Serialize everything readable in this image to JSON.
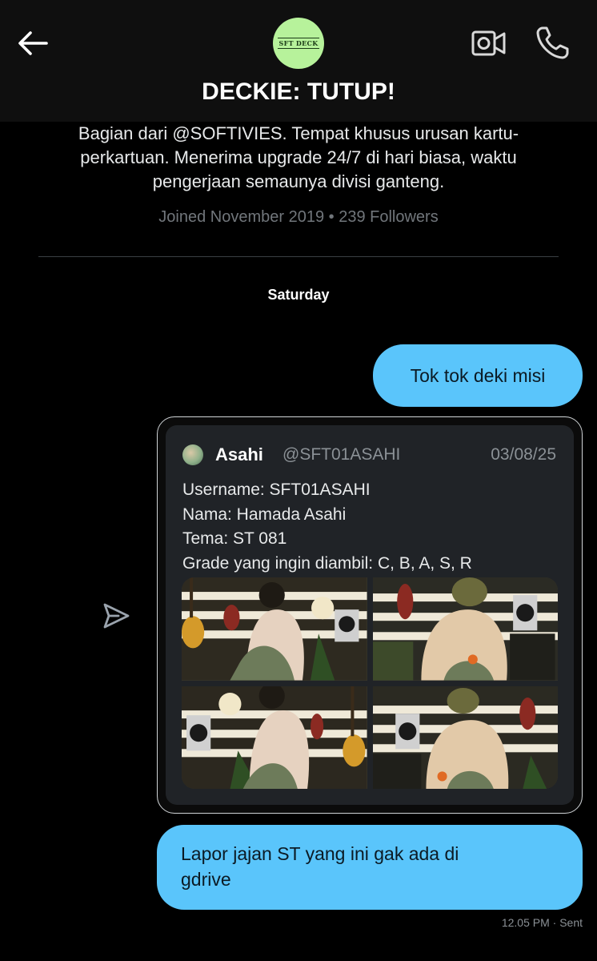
{
  "header": {
    "back_icon": "arrow-left-icon",
    "avatar_text": "SFT DECK",
    "video_icon": "video-camera-icon",
    "call_icon": "phone-icon",
    "title": "DECKIE: TUTUP!"
  },
  "profile": {
    "bio_line1": "Bagian dari @SOFTIVIES. Tempat khusus urusan kartu-",
    "bio_line2": "perkartuan. Menerima upgrade 24/7 di hari biasa, waktu",
    "bio_line3": "pengerjaan semaunya divisi ganteng.",
    "meta": "Joined November 2019 • 239 Followers"
  },
  "conversation": {
    "date_label": "Saturday",
    "message1": "Tok tok deki misi",
    "share_icon": "send-icon",
    "quoted_post": {
      "author_name": "Asahi",
      "author_handle": "@SFT01ASAHI",
      "date": "03/08/25",
      "lines": [
        "Username: SFT01ASAHI",
        "Nama: Hamada Asahi",
        "Tema: ST 081",
        "Grade yang ingin diambil: C, B, A, S, R"
      ],
      "photo_count": 4
    },
    "message2_line1": "Lapor jajan ST yang ini gak ada di",
    "message2_line2": "gdrive",
    "status": "12.05 PM · Sent"
  },
  "colors": {
    "bubble": "#5ac5fb",
    "avatar_bg": "#b7f29b",
    "muted": "#71767b",
    "card_bg": "#202327"
  }
}
